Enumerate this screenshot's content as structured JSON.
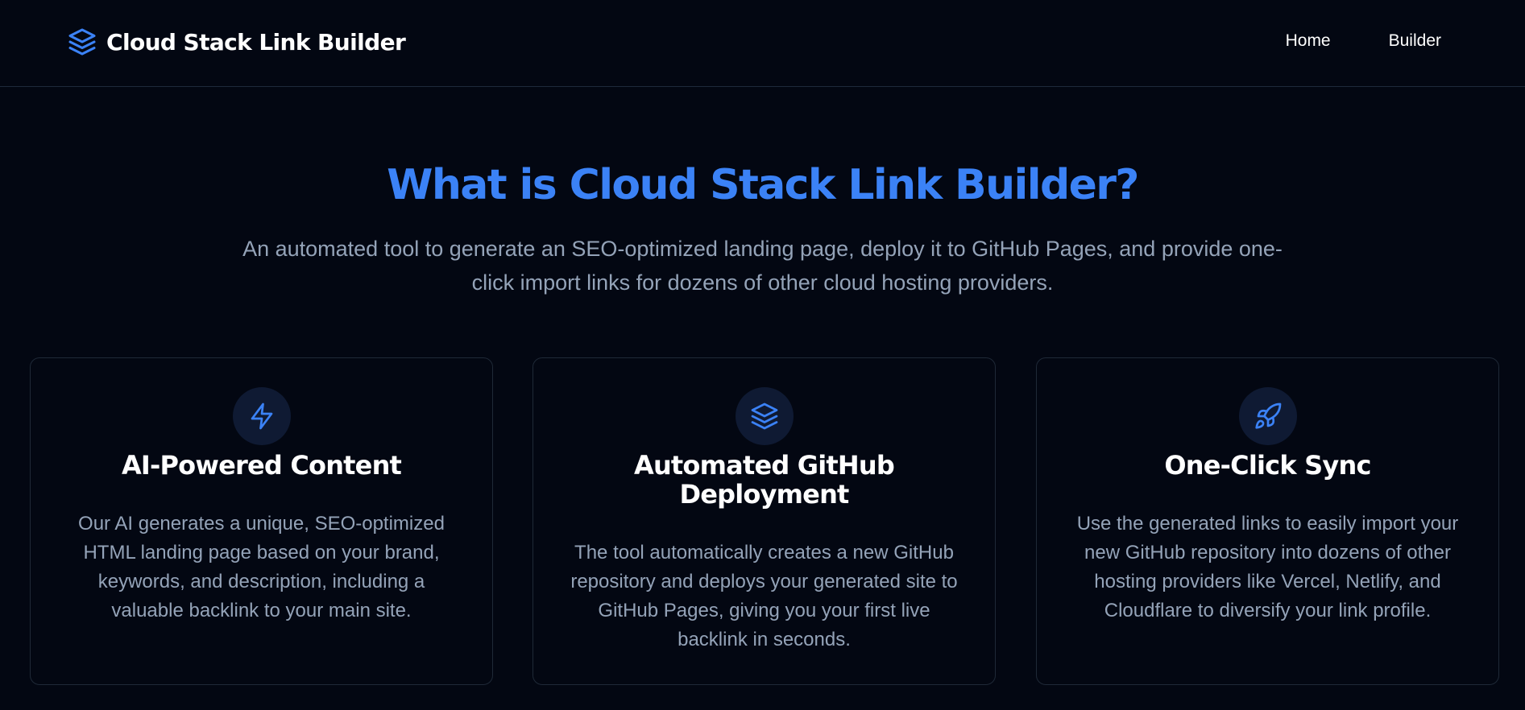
{
  "header": {
    "brand_title": "Cloud Stack Link Builder",
    "brand_icon": "layers-icon",
    "nav": [
      {
        "label": "Home"
      },
      {
        "label": "Builder"
      }
    ]
  },
  "hero": {
    "title": "What is Cloud Stack Link Builder?",
    "subtitle": "An automated tool to generate an SEO-optimized landing page, deploy it to GitHub Pages, and provide one-click import links for dozens of other cloud hosting providers."
  },
  "features": [
    {
      "icon": "lightning-icon",
      "title": "AI-Powered Content",
      "description": "Our AI generates a unique, SEO-optimized HTML landing page based on your brand, keywords, and description, including a valuable backlink to your main site."
    },
    {
      "icon": "layers-icon",
      "title": "Automated GitHub Deployment",
      "description": "The tool automatically creates a new GitHub repository and deploys your generated site to GitHub Pages, giving you your first live backlink in seconds."
    },
    {
      "icon": "rocket-icon",
      "title": "One-Click Sync",
      "description": "Use the generated links to easily import your new GitHub repository into dozens of other hosting providers like Vercel, Netlify, and Cloudflare to diversify your link profile."
    }
  ],
  "colors": {
    "background": "#030712",
    "accent": "#3b82f6",
    "muted_text": "#94a3b8",
    "border": "#1f2937",
    "icon_bg": "#0f1a33"
  }
}
